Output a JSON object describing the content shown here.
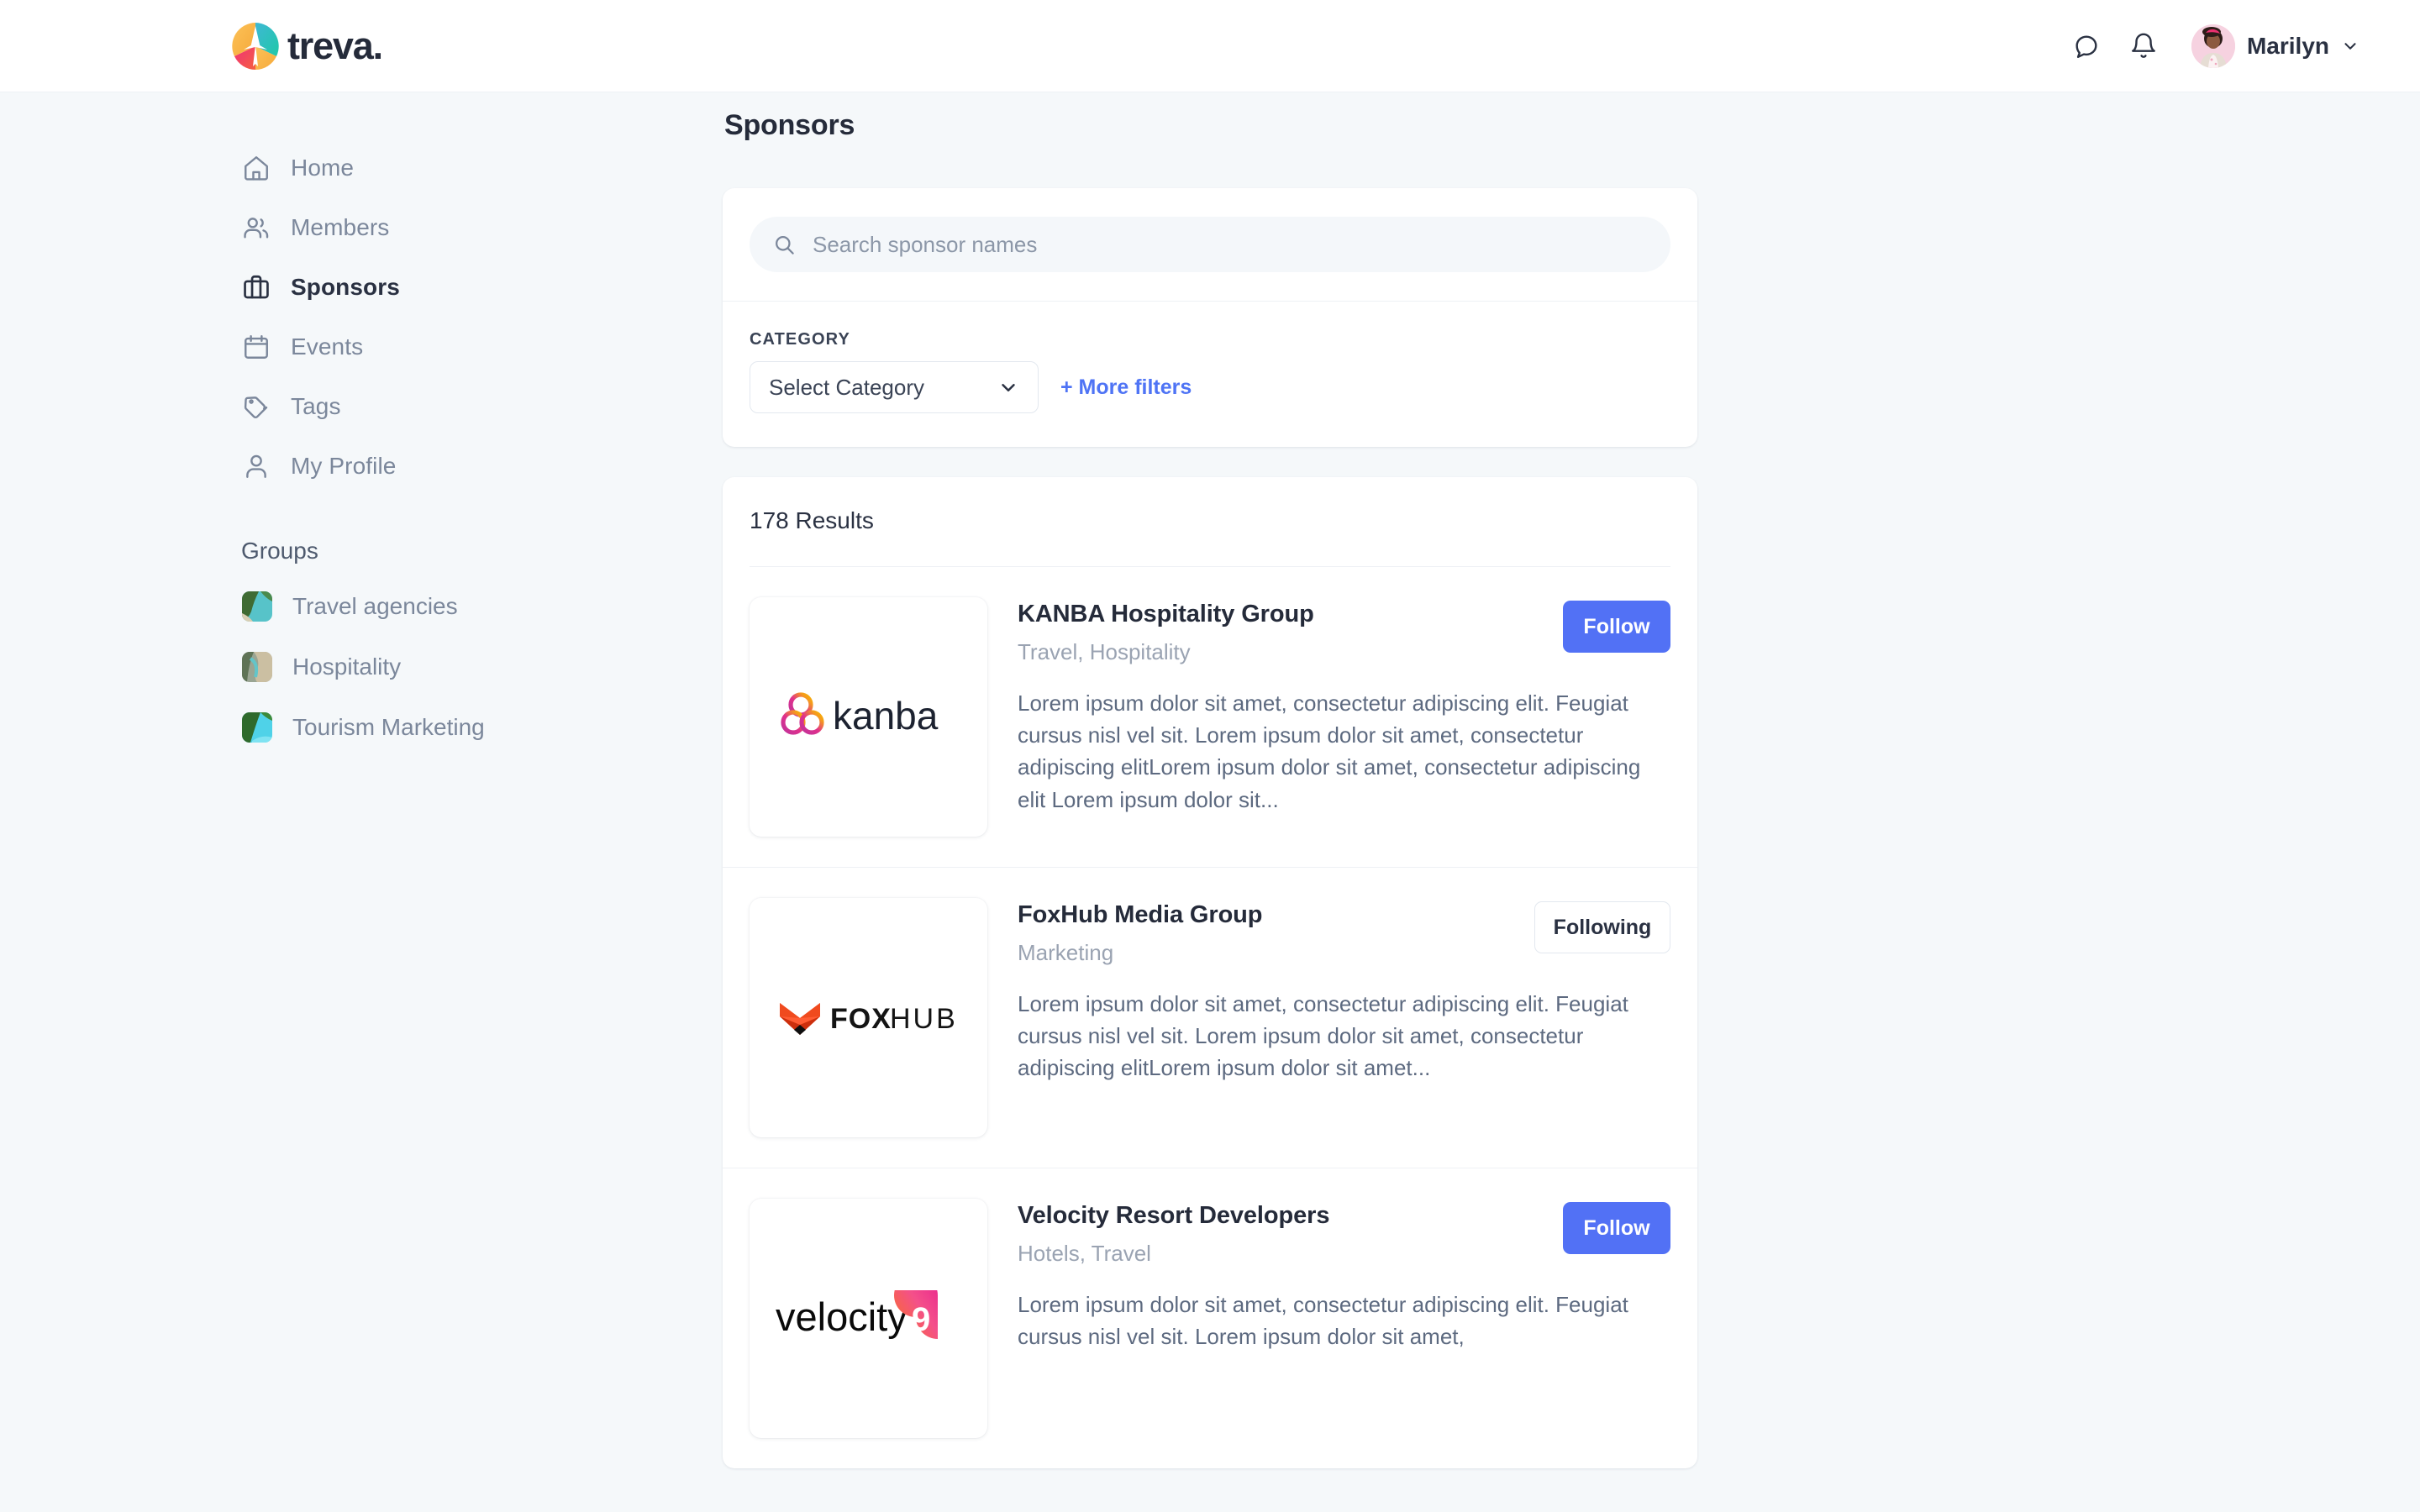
{
  "brand": {
    "name": "treva.",
    "logo_icon": "treva-plane-circle-logo"
  },
  "header": {
    "chat_icon": "chat-bubble-icon",
    "bell_icon": "notification-bell-icon",
    "user_name": "Marilyn",
    "avatar_icon": "user-avatar",
    "chevron_icon": "chevron-down-icon"
  },
  "sidebar": {
    "items": [
      {
        "label": "Home",
        "icon": "home-icon",
        "active": false
      },
      {
        "label": "Members",
        "icon": "members-icon",
        "active": false
      },
      {
        "label": "Sponsors",
        "icon": "briefcase-icon",
        "active": true
      },
      {
        "label": "Events",
        "icon": "calendar-icon",
        "active": false
      },
      {
        "label": "Tags",
        "icon": "tag-icon",
        "active": false
      },
      {
        "label": "My Profile",
        "icon": "person-icon",
        "active": false
      }
    ],
    "groups_title": "Groups",
    "groups": [
      {
        "label": "Travel agencies",
        "icon": "group-thumbnail-beach"
      },
      {
        "label": "Hospitality",
        "icon": "group-thumbnail-coast"
      },
      {
        "label": "Tourism Marketing",
        "icon": "group-thumbnail-lagoon"
      }
    ]
  },
  "main": {
    "page_title": "Sponsors",
    "search": {
      "placeholder": "Search sponsor names",
      "value": "",
      "icon": "search-icon"
    },
    "filters": {
      "category_label": "CATEGORY",
      "category_value": "Select Category",
      "chevron_icon": "chevron-down-icon",
      "more_filters_label": "+ More filters"
    },
    "results_count": "178 Results",
    "sponsors": [
      {
        "name": "KANBA Hospitality Group",
        "categories": "Travel, Hospitality",
        "description": "Lorem ipsum dolor sit amet, consectetur adipiscing elit. Feugiat cursus nisl vel sit. Lorem ipsum dolor sit amet, consectetur adipiscing elitLorem ipsum dolor sit amet, consectetur adipiscing elit Lorem ipsum dolor sit...",
        "logo": "kanba-logo",
        "button_label": "Follow",
        "button_state": "follow"
      },
      {
        "name": "FoxHub Media Group",
        "categories": "Marketing",
        "description": "Lorem ipsum dolor sit amet, consectetur adipiscing elit. Feugiat cursus nisl vel sit. Lorem ipsum dolor sit amet, consectetur adipiscing elitLorem ipsum dolor sit amet...",
        "logo": "foxhub-logo",
        "button_label": "Following",
        "button_state": "following"
      },
      {
        "name": "Velocity Resort Developers",
        "categories": "Hotels, Travel",
        "description": "Lorem ipsum dolor sit amet, consectetur adipiscing elit. Feugiat cursus nisl vel sit. Lorem ipsum dolor sit amet,",
        "logo": "velocity-logo",
        "button_label": "Follow",
        "button_state": "follow"
      }
    ]
  },
  "colors": {
    "accent": "#5271f5",
    "link": "#4f74f5",
    "page_bg": "#f5f8fa",
    "text_dark": "#252b3a",
    "text_muted": "#7b879b"
  }
}
